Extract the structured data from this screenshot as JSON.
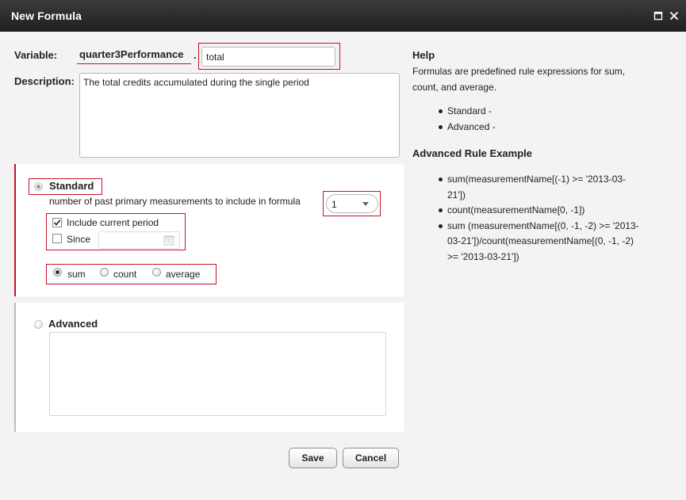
{
  "window": {
    "title": "New Formula",
    "icons": [
      "maximize-icon",
      "close-icon"
    ]
  },
  "form": {
    "variable_label": "Variable:",
    "variable_name": "quarter3Performance",
    "separator": ".",
    "variable_field_value": "total",
    "description_label": "Description:",
    "description_value": "The total credits accumulated during the single period"
  },
  "standard": {
    "label": "Standard",
    "selected": true,
    "past_measurements_label": "number of past primary measurements to include in formula",
    "past_measurements_value": "1",
    "include_current_label": "Include current period",
    "include_current_checked": true,
    "since_label": "Since",
    "since_checked": false,
    "since_value": "",
    "aggregations": [
      {
        "label": "sum",
        "checked": true
      },
      {
        "label": "count",
        "checked": false
      },
      {
        "label": "average",
        "checked": false
      }
    ]
  },
  "advanced": {
    "label": "Advanced",
    "selected": false,
    "expression_value": ""
  },
  "buttons": {
    "save": "Save",
    "cancel": "Cancel"
  },
  "help": {
    "title": "Help",
    "description": "Formulas are predefined rule expressions for sum, count, and average.",
    "items": [
      "Standard -",
      "Advanced -"
    ],
    "example_title": "Advanced Rule Example",
    "examples": [
      "sum(measurementName[(-1) >= '2013-03-21'])",
      "count(measurementName[0, -1])",
      "sum (measurementName[(0, -1, -2) >= '2013-03-21'])/count(measurementName[(0, -1, -2) >= '2013-03-21'])"
    ]
  },
  "colors": {
    "titlebar": "#2a2a2a",
    "highlight_red": "#c8102e",
    "panel_bg": "#ffffff",
    "window_bg": "#f3f3f3"
  }
}
